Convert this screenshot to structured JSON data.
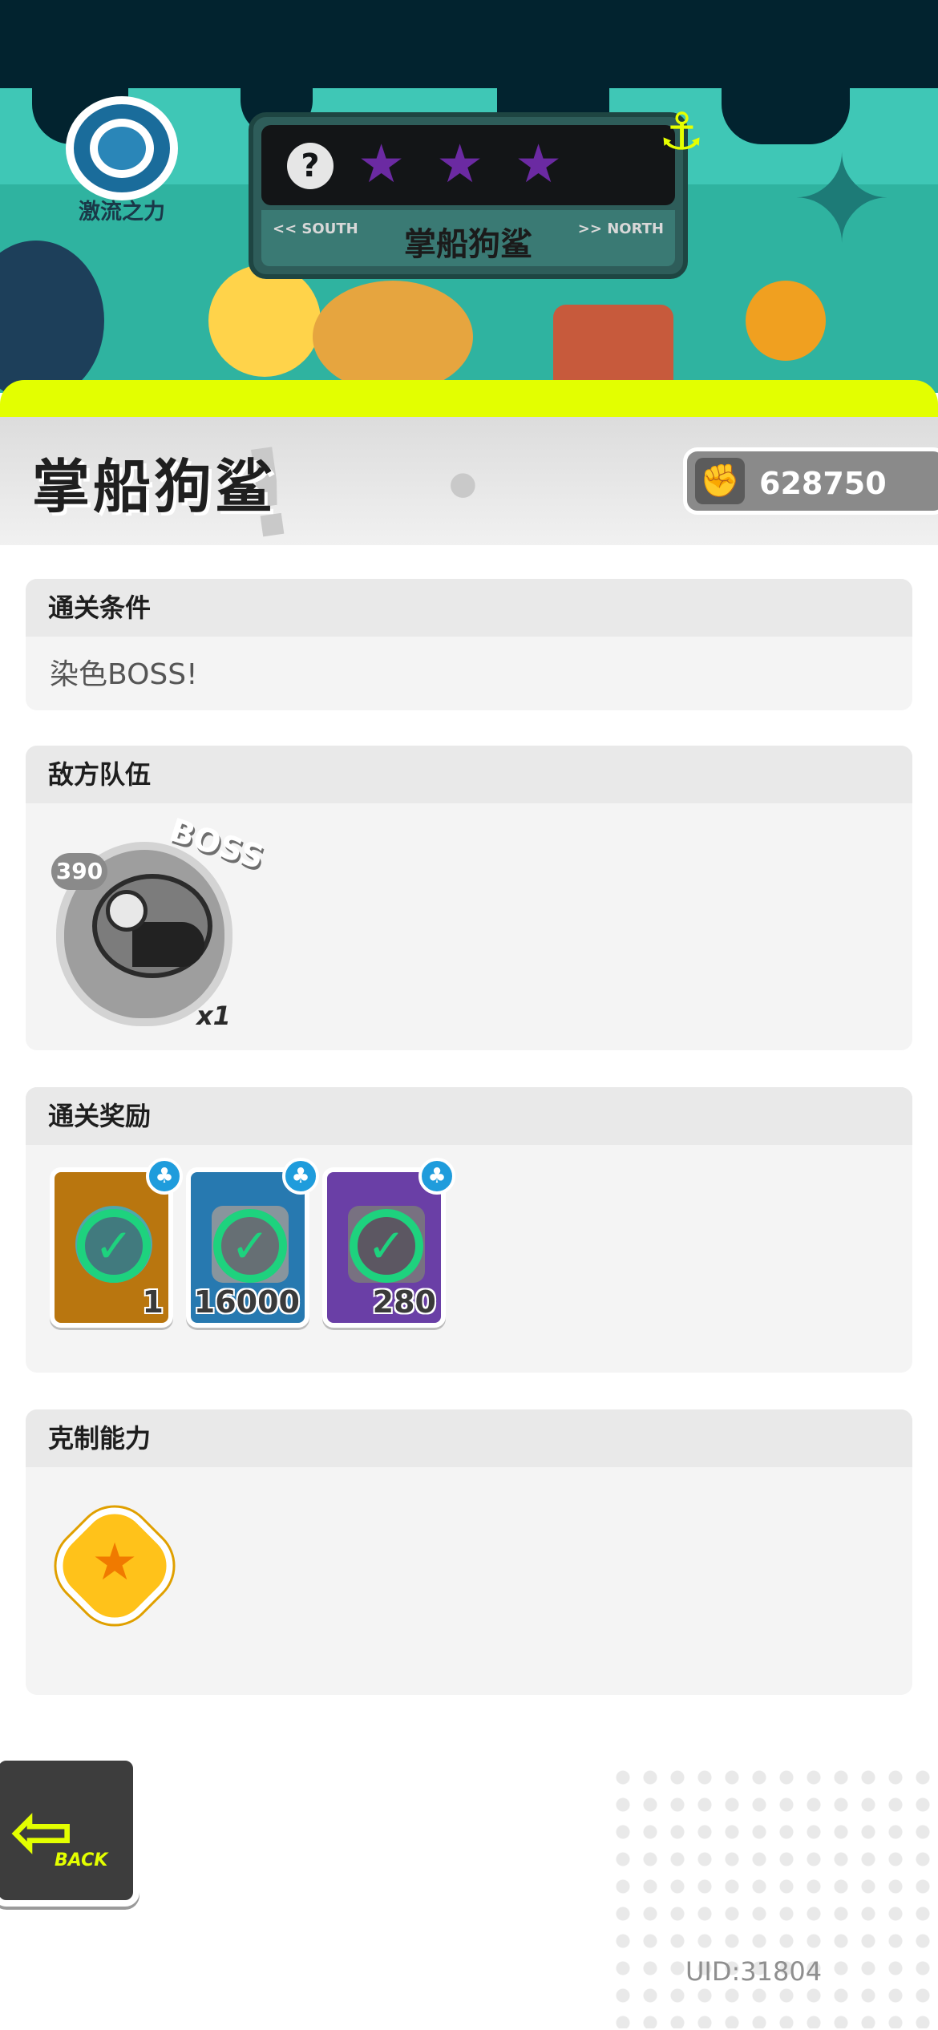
{
  "region": {
    "label": "激流之力"
  },
  "level_card": {
    "question_mark": "?",
    "stars_earned": 3,
    "star_glyph": "★",
    "nav_left": "<< SOUTH",
    "nav_right": ">> NORTH",
    "name": "掌船狗鲨"
  },
  "header": {
    "title": "掌船狗鲨",
    "power_value": "628750",
    "power_icon": "fist-icon"
  },
  "clear_condition": {
    "header": "通关条件",
    "text": "染色BOSS!"
  },
  "enemy_team": {
    "header": "敌方队伍",
    "enemies": [
      {
        "level": "390",
        "tag": "BOSS",
        "count": "x1",
        "icon": "shark-boss-icon"
      }
    ]
  },
  "rewards": {
    "header": "通关奖励",
    "items": [
      {
        "icon": "water-drop-icon",
        "quantity": "1",
        "frame_color": "#b9760f",
        "claimed": true,
        "source_icon": "island-icon"
      },
      {
        "icon": "ticket-icon",
        "quantity": "16000",
        "frame_color": "#2779b0",
        "claimed": true,
        "source_icon": "island-icon"
      },
      {
        "icon": "gear-token-icon",
        "quantity": "280",
        "frame_color": "#6a3fa6",
        "claimed": true,
        "source_icon": "island-icon"
      }
    ]
  },
  "counter_ability": {
    "header": "克制能力",
    "icon": "star-burst-ability-icon"
  },
  "back_button": {
    "label": "BACK"
  },
  "footer": {
    "uid": "UID:31804"
  },
  "colors": {
    "accent_yellow": "#e3ff00",
    "check_green": "#1ed27e",
    "banner_teal": "#3fc7b6"
  }
}
